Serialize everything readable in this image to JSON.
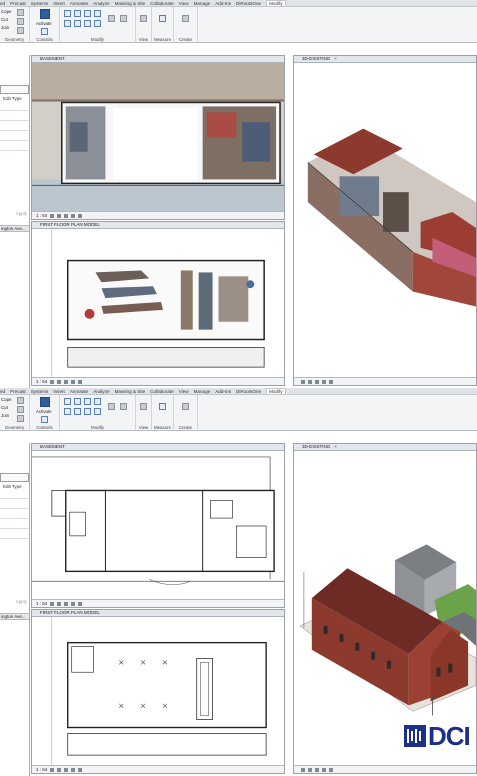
{
  "menu": {
    "tabs": [
      "ed",
      "Precast",
      "Systems",
      "Insert",
      "Annotate",
      "Analyze",
      "Massing & Site",
      "Collaborate",
      "View",
      "Manage",
      "Add-Ins",
      "DiRootsOne",
      "Modify"
    ],
    "active": "Modify"
  },
  "ribbon": {
    "cope_label": "Cope",
    "cut_label": "Cut",
    "join_label": "Join",
    "activate_label": "Activate",
    "groups": {
      "geometry": "Geometry",
      "controls": "Controls",
      "modify": "Modify",
      "view": "View",
      "measure": "Measure",
      "create": "Create"
    }
  },
  "properties": {
    "edit_type": "Edit Type",
    "apply": "Apply",
    "browser_item": "ington Ave..."
  },
  "views": {
    "basement": {
      "title": "BASEMENT",
      "scale": "1 : 64"
    },
    "first_floor": {
      "title": "FIRST FLOOR PLAN MODEL",
      "scale": "1 : 64"
    },
    "three_d": {
      "title": "3D-EXISTING"
    }
  },
  "brand": {
    "text": "DCI",
    "color": "#1c2f8a"
  },
  "colors": {
    "ribbon_bg": "#f3f4f6",
    "brick": "#8c3a2e",
    "roof": "#6e2a24",
    "grass": "#6ba34a"
  }
}
